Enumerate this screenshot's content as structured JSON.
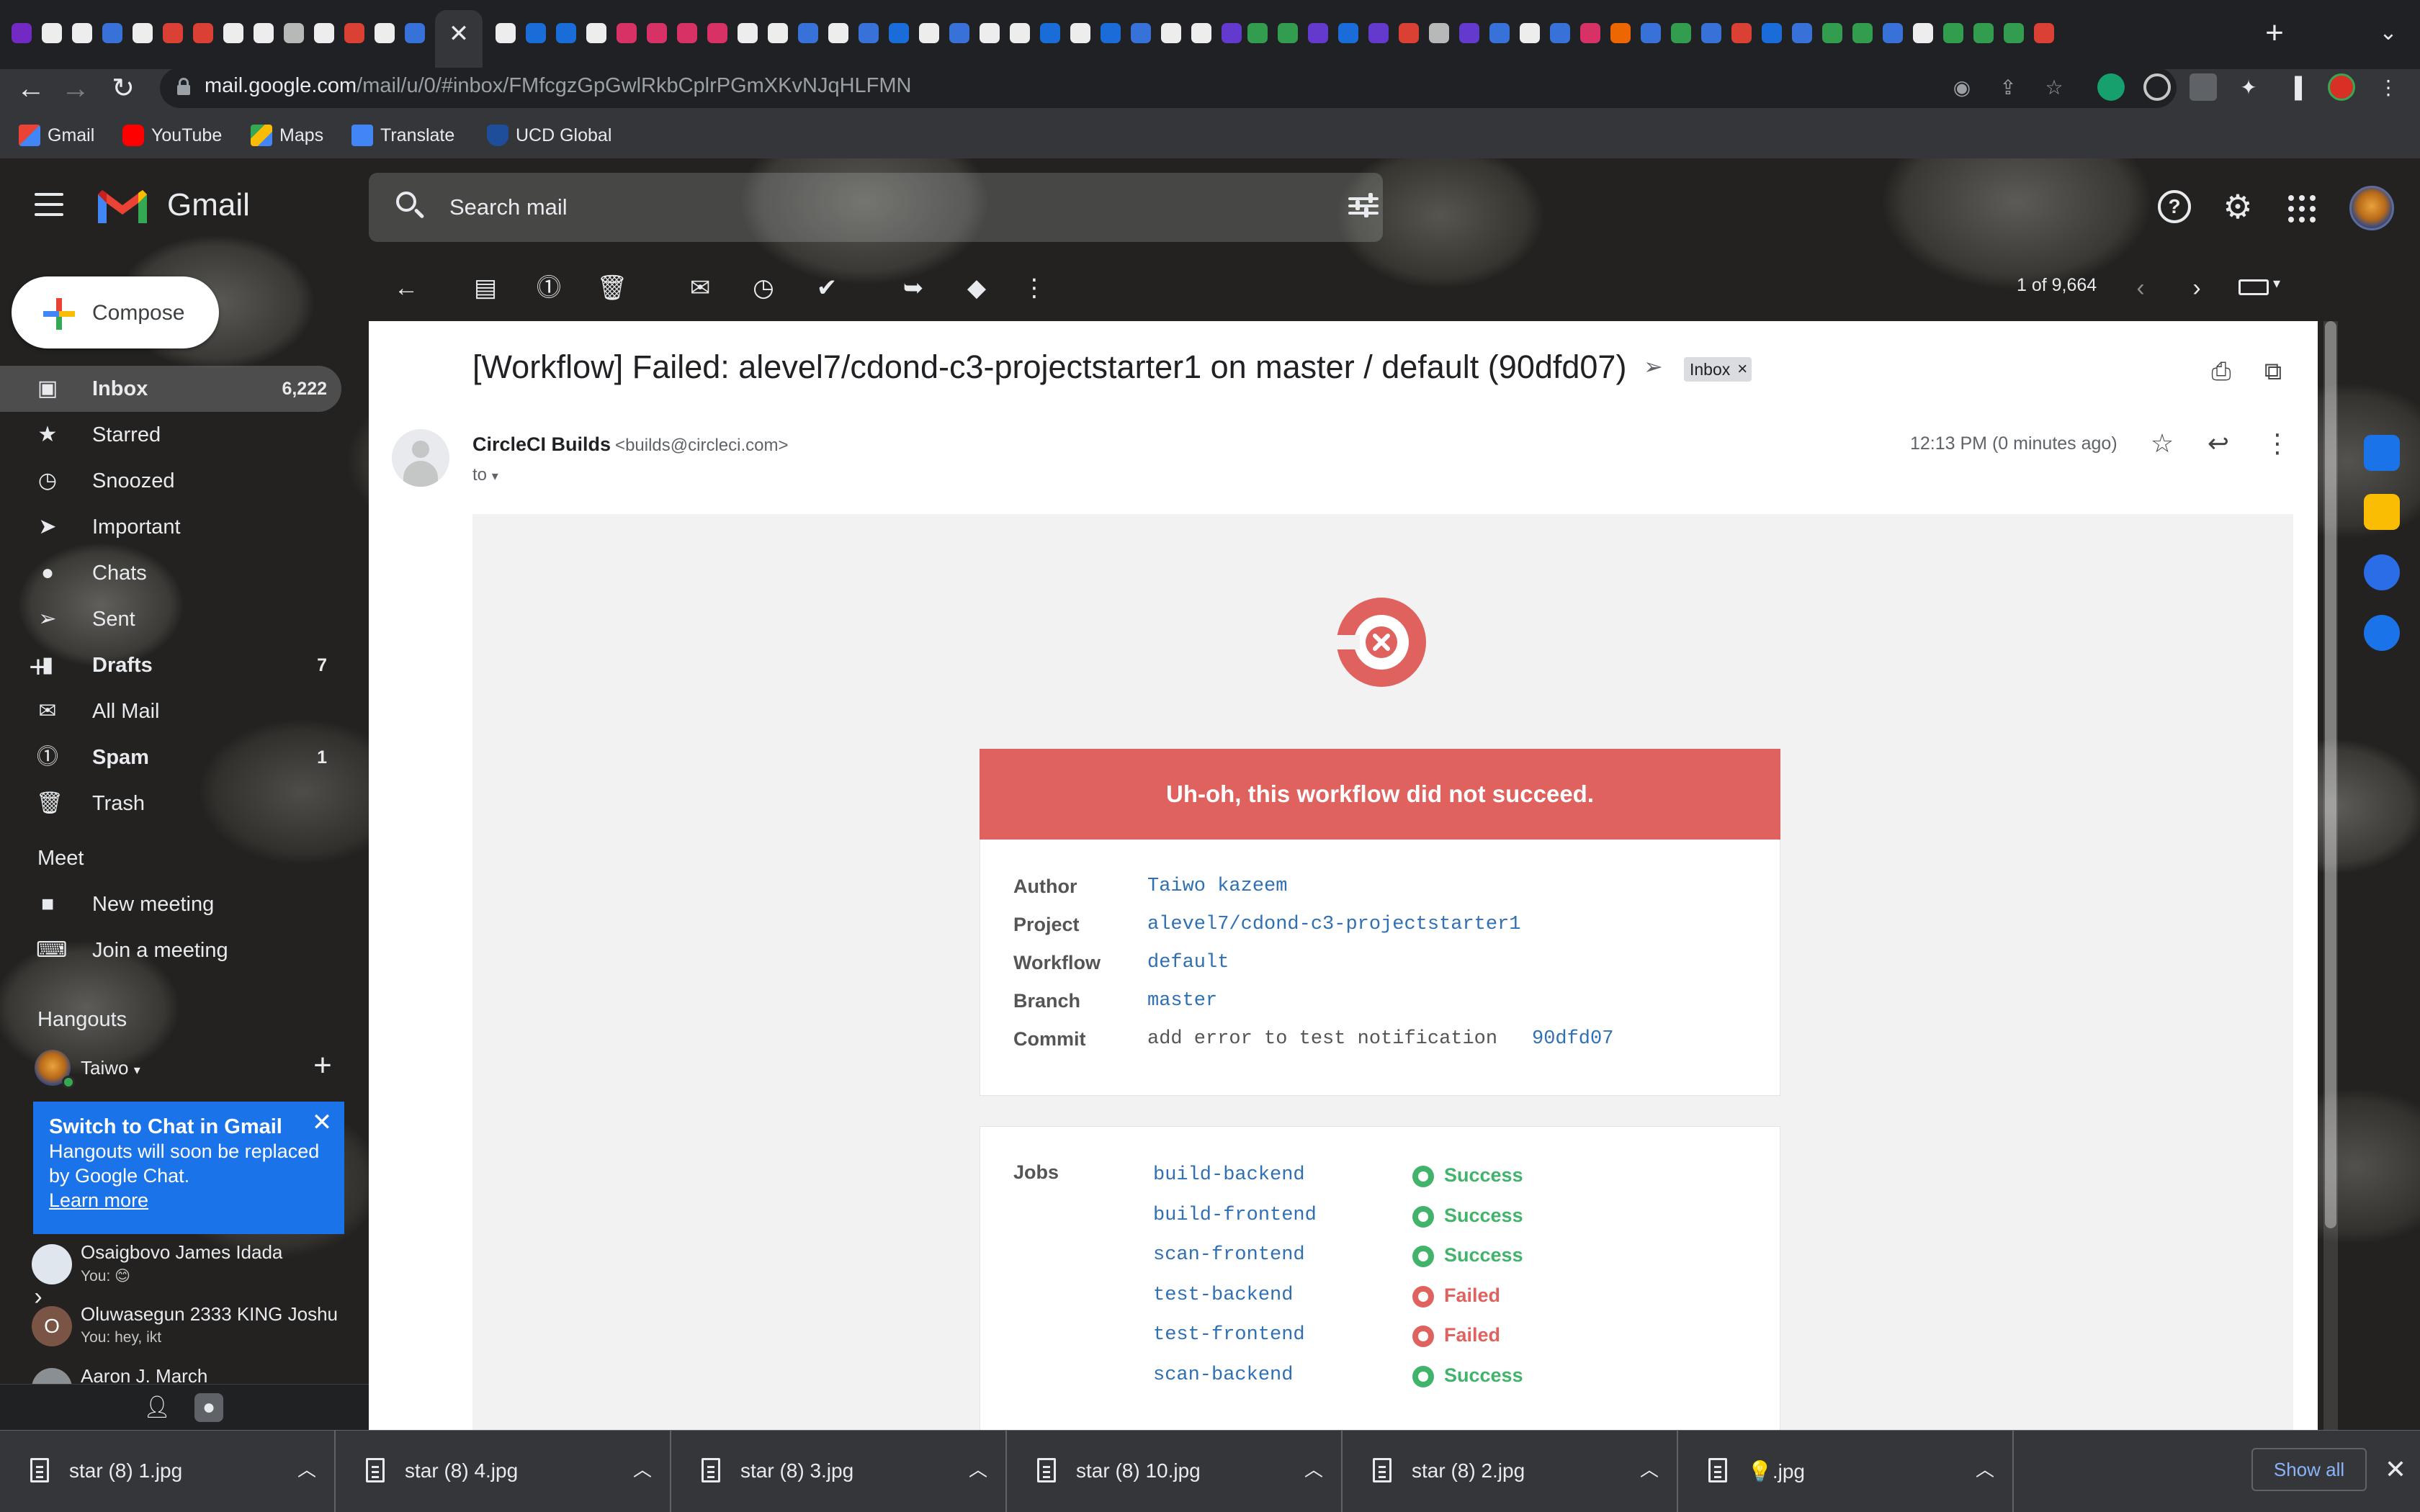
{
  "browser": {
    "active_tab_close": "✕",
    "new_tab": "+",
    "url_host": "mail.google.com",
    "url_path": "/mail/u/0/#inbox/FMfcgzGpGwlRkbCplrPGmXKvNJqHLFMN",
    "bookmarks": [
      "Gmail",
      "YouTube",
      "Maps",
      "Translate",
      "UCD Global"
    ]
  },
  "gmail": {
    "brand": "Gmail",
    "search_placeholder": "Search mail",
    "compose_label": "Compose",
    "nav": [
      {
        "label": "Inbox",
        "count": "6,222"
      },
      {
        "label": "Starred",
        "count": ""
      },
      {
        "label": "Snoozed",
        "count": ""
      },
      {
        "label": "Important",
        "count": ""
      },
      {
        "label": "Chats",
        "count": ""
      },
      {
        "label": "Sent",
        "count": ""
      },
      {
        "label": "Drafts",
        "count": "7"
      },
      {
        "label": "All Mail",
        "count": ""
      },
      {
        "label": "Spam",
        "count": "1"
      },
      {
        "label": "Trash",
        "count": ""
      }
    ],
    "meet": {
      "heading": "Meet",
      "new_meeting": "New meeting",
      "join_meeting": "Join a meeting"
    },
    "hangouts": {
      "heading": "Hangouts",
      "user": "Taiwo",
      "popup_title": "Switch to Chat in Gmail",
      "popup_body": "Hangouts will soon be replaced by Google Chat.",
      "popup_link": "Learn more",
      "contacts": [
        {
          "name": "Osaigbovo James Idada",
          "preview": "You: 😊",
          "initial": ""
        },
        {
          "name": "Oluwasegun 2333 KING Joshu",
          "preview": "You: hey, ikt",
          "initial": "O"
        },
        {
          "name": "Aaron J. March",
          "preview": "",
          "initial": ""
        }
      ]
    },
    "toolbar": {
      "page_count": "1 of 9,664"
    }
  },
  "message": {
    "subject": "[Workflow] Failed: alevel7/cdond-c3-projectstarter1 on master / default (90dfd07)",
    "label_chip": "Inbox",
    "sender_name": "CircleCI Builds",
    "sender_email": "<builds@circleci.com>",
    "to": "to",
    "time": "12:13 PM (0 minutes ago)",
    "body": {
      "banner": "Uh-oh, this workflow did not succeed.",
      "info": [
        {
          "key": "Author",
          "value": "Taiwo kazeem",
          "extra": ""
        },
        {
          "key": "Project",
          "value": "alevel7/cdond-c3-projectstarter1",
          "extra": ""
        },
        {
          "key": "Workflow",
          "value": "default",
          "extra": ""
        },
        {
          "key": "Branch",
          "value": "master",
          "extra": ""
        },
        {
          "key": "Commit",
          "value": "add error to test notification",
          "extra": "90dfd07"
        }
      ],
      "jobs_label": "Jobs",
      "jobs": [
        {
          "name": "build-backend",
          "status": "Success"
        },
        {
          "name": "build-frontend",
          "status": "Success"
        },
        {
          "name": "scan-frontend",
          "status": "Success"
        },
        {
          "name": "test-backend",
          "status": "Failed"
        },
        {
          "name": "test-frontend",
          "status": "Failed"
        },
        {
          "name": "scan-backend",
          "status": "Success"
        }
      ]
    }
  },
  "downloads": {
    "files": [
      "star (8) 1.jpg",
      "star (8) 4.jpg",
      "star (8) 3.jpg",
      "star (8) 10.jpg",
      "star (8) 2.jpg",
      "💡.jpg"
    ],
    "show_all": "Show all"
  },
  "colors": {
    "failure": "#e0625f",
    "success": "#42b36a",
    "link": "#2f70b5",
    "accent_blue": "#1a73e8"
  }
}
